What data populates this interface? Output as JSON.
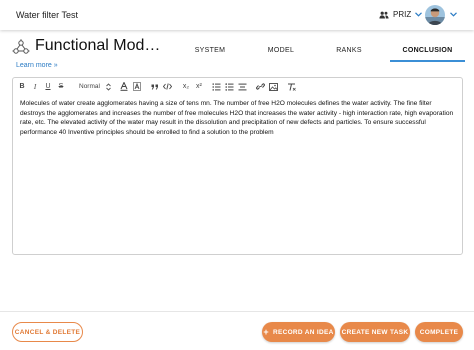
{
  "app": {
    "title": "Water filter Test",
    "team_label": "PRIZ",
    "team_icon": "people-icon",
    "avatar_icon": "user-avatar"
  },
  "tool": {
    "icon": "molecule-icon",
    "title": "Functional Mod…",
    "learn_more": "Learn more »"
  },
  "tabs": [
    {
      "label": "SYSTEM",
      "active": false
    },
    {
      "label": "MODEL",
      "active": false
    },
    {
      "label": "RANKS",
      "active": false
    },
    {
      "label": "CONCLUSION",
      "active": true
    }
  ],
  "editor": {
    "toolbar": {
      "bold": "B",
      "italic": "I",
      "underline": "U",
      "strike": "S",
      "format_select": "Normal",
      "subscript": "x₂",
      "superscript": "x²"
    },
    "content": "Molecules of water create agglomerates having a size of tens mn. The number of free H2O molecules defines the water activity. The fine filter destroys the agglomerates and increases the number of free molecules H2O that increases the water activity - high interaction rate, high evaporation rate, etc. The elevated activity of the water may result in the dissolution and precipitation of new defects and particles. To ensure successful performance 40 Inventive principles should be enrolled to find a solution to the problem"
  },
  "buttons": {
    "cancel_delete": "CANCEL & DELETE",
    "record_idea": "RECORD AN IDEA",
    "create_task": "CREATE NEW TASK",
    "complete": "COMPLETE"
  },
  "colors": {
    "accent_orange": "#e8894a",
    "tab_underline": "#3b8fd6",
    "link_blue": "#2a7bc4"
  }
}
